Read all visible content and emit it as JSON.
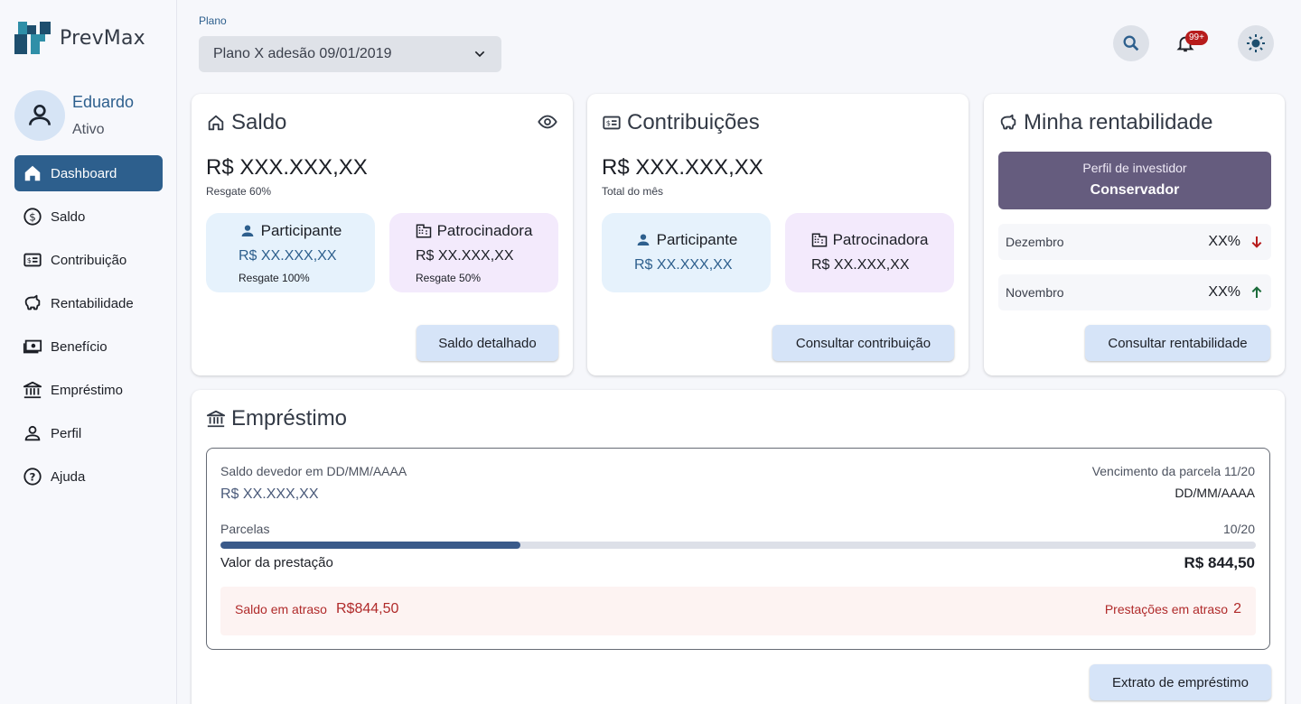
{
  "app": {
    "name": "PrevMax"
  },
  "user": {
    "name": "Eduardo",
    "status": "Ativo"
  },
  "sidebar": {
    "items": [
      {
        "label": "Dashboard",
        "icon": "home-icon",
        "active": true
      },
      {
        "label": "Saldo",
        "icon": "dollar-circle-icon"
      },
      {
        "label": "Contribuição",
        "icon": "receipt-icon"
      },
      {
        "label": "Rentabilidade",
        "icon": "piggy-bank-icon"
      },
      {
        "label": "Benefício",
        "icon": "money-icon"
      },
      {
        "label": "Empréstimo",
        "icon": "bank-icon"
      },
      {
        "label": "Perfil",
        "icon": "person-icon"
      },
      {
        "label": "Ajuda",
        "icon": "help-circle-icon"
      }
    ]
  },
  "header": {
    "plan_label": "Plano",
    "plan_value": "Plano X adesão 09/01/2019",
    "notification_badge": "99+"
  },
  "saldo": {
    "title": "Saldo",
    "amount": "R$ XXX.XXX,XX",
    "amount_sub": "Resgate 60%",
    "participante": {
      "label": "Participante",
      "value": "R$ XX.XXX,XX",
      "sub": "Resgate 100%"
    },
    "patrocinadora": {
      "label": "Patrocinadora",
      "value": "R$ XX.XXX,XX",
      "sub": "Resgate 50%"
    },
    "button": "Saldo detalhado"
  },
  "contribuicoes": {
    "title": "Contribuições",
    "amount": "R$ XXX.XXX,XX",
    "amount_sub": "Total do mês",
    "participante": {
      "label": "Participante",
      "value": "R$ XX.XXX,XX"
    },
    "patrocinadora": {
      "label": "Patrocinadora",
      "value": "R$ XX.XXX,XX"
    },
    "button": "Consultar contribuição"
  },
  "rentabilidade": {
    "title": "Minha rentabilidade",
    "profile_label": "Perfil de investidor",
    "profile_value": "Conservador",
    "rows": [
      {
        "month": "Dezembro",
        "value": "XX%",
        "trend": "down",
        "color": "#b71c1c"
      },
      {
        "month": "Novembro",
        "value": "XX%",
        "trend": "up",
        "color": "#1b6b3a"
      }
    ],
    "button": "Consultar rentabilidade"
  },
  "emprestimo": {
    "title": "Empréstimo",
    "saldo_devedor_label": "Saldo devedor em DD/MM/AAAA",
    "saldo_devedor_value": "R$ XX.XXX,XX",
    "vencimento_label": "Vencimento da parcela 11/20",
    "vencimento_value": "DD/MM/AAAA",
    "parcelas_label": "Parcelas",
    "parcelas_value": "10/20",
    "progress": 0.29,
    "prestacao_label": "Valor da prestação",
    "prestacao_value": "R$ 844,50",
    "atraso_label": "Saldo em atraso",
    "atraso_value": "R$844,50",
    "prest_atraso_label": "Prestações em atraso",
    "prest_atraso_value": "2",
    "button": "Extrato de empréstimo"
  },
  "colors": {
    "primary": "#2d5f8d",
    "profile": "#655c7e",
    "alert": "#b02a2a"
  }
}
